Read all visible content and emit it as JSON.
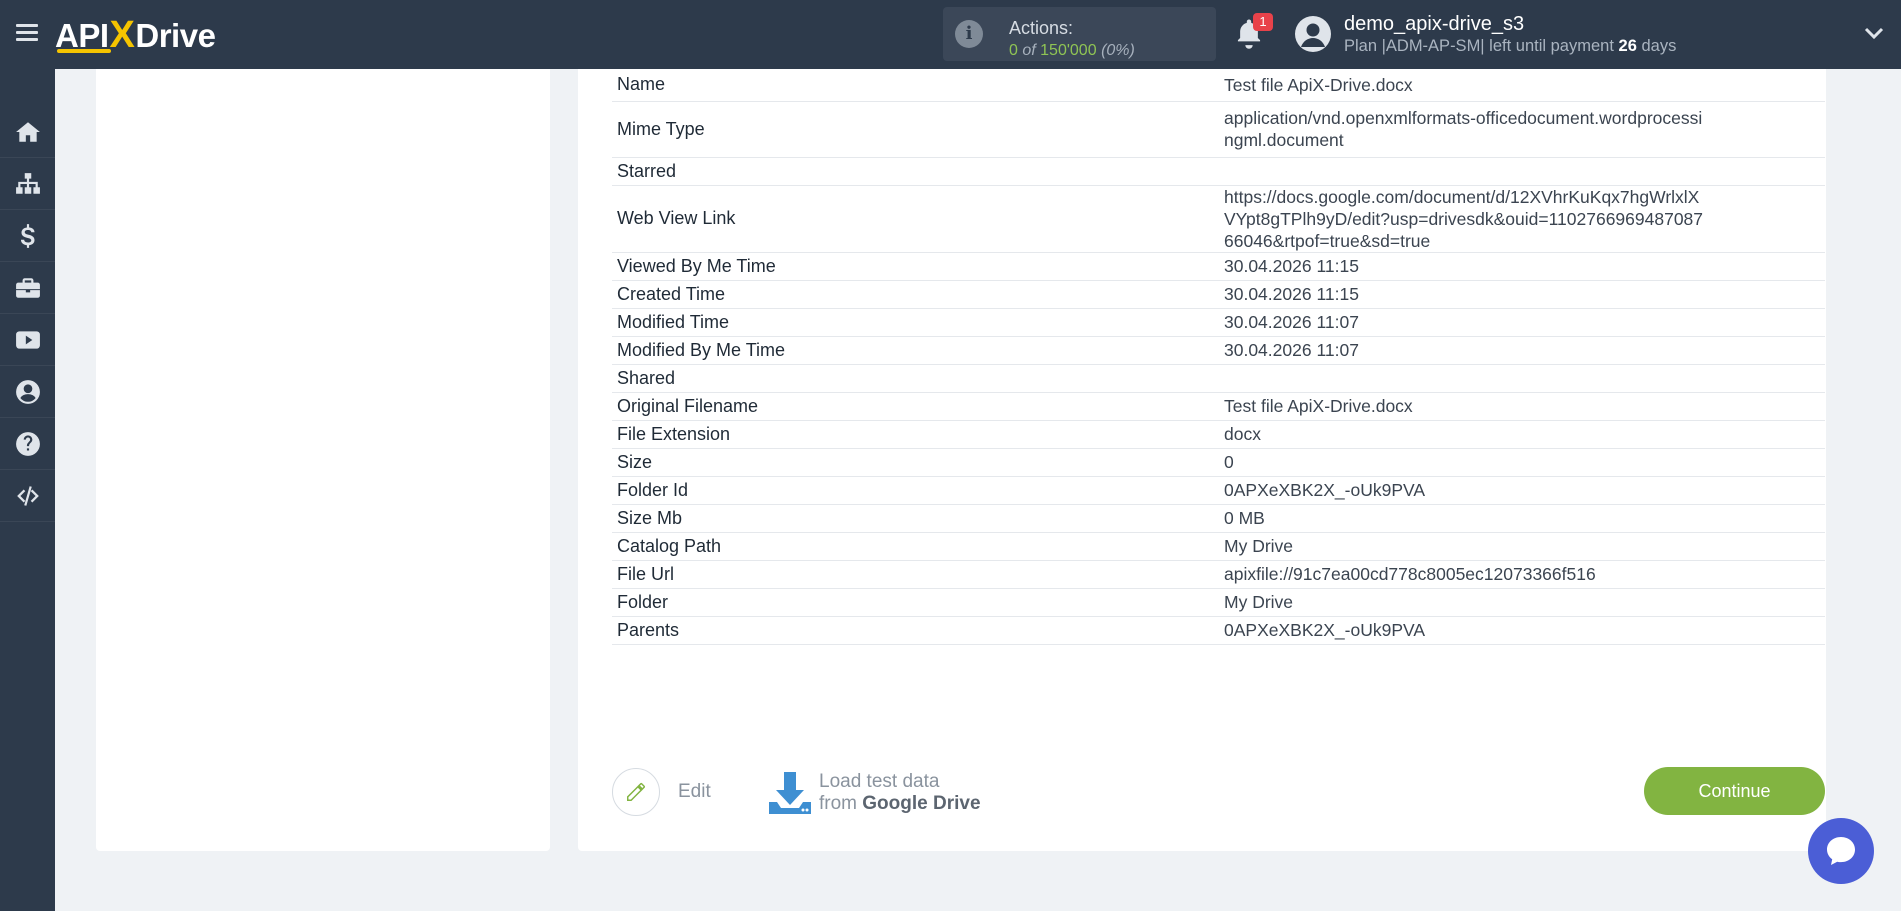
{
  "header": {
    "logo_prefix": "API",
    "logo_x": "X",
    "logo_suffix": "Drive",
    "actions_label": "Actions:",
    "actions_used": "0",
    "actions_of": "of",
    "actions_total": "150'000",
    "actions_percent": "(0%)",
    "notifications_count": "1",
    "user_name": "demo_apix-drive_s3",
    "plan_text": "Plan |ADM-AP-SM| left until payment",
    "days_left": "26",
    "days_unit": "days"
  },
  "sidebar": {
    "items": [
      {
        "icon": "home-icon"
      },
      {
        "icon": "sitemap-icon"
      },
      {
        "icon": "dollar-icon"
      },
      {
        "icon": "briefcase-icon"
      },
      {
        "icon": "youtube-icon"
      },
      {
        "icon": "user-circle-icon"
      },
      {
        "icon": "question-icon"
      },
      {
        "icon": "code-icon"
      }
    ]
  },
  "fields": [
    {
      "key": "Name",
      "value": "Test file ApiX-Drive.docx"
    },
    {
      "key": "Mime Type",
      "value": "application/vnd.openxmlformats-officedocument.wordprocessingml.document"
    },
    {
      "key": "Starred",
      "value": ""
    },
    {
      "key": "Web View Link",
      "value": "https://docs.google.com/document/d/12XVhrKuKqx7hgWrlxlXVYpt8gTPlh9yD/edit?usp=drivesdk&ouid=110276696948708766046&rtpof=true&sd=true"
    },
    {
      "key": "Viewed By Me Time",
      "value": "30.04.2026 11:15"
    },
    {
      "key": "Created Time",
      "value": "30.04.2026 11:15"
    },
    {
      "key": "Modified Time",
      "value": "30.04.2026 11:07"
    },
    {
      "key": "Modified By Me Time",
      "value": "30.04.2026 11:07"
    },
    {
      "key": "Shared",
      "value": ""
    },
    {
      "key": "Original Filename",
      "value": "Test file ApiX-Drive.docx"
    },
    {
      "key": "File Extension",
      "value": "docx"
    },
    {
      "key": "Size",
      "value": "0"
    },
    {
      "key": "Folder Id",
      "value": "0APXeXBK2X_-oUk9PVA"
    },
    {
      "key": "Size Mb",
      "value": "0 MB"
    },
    {
      "key": "Catalog Path",
      "value": "My Drive"
    },
    {
      "key": "File Url",
      "value": "apixfile://91c7ea00cd778c8005ec12073366f516"
    },
    {
      "key": "Folder",
      "value": "My Drive"
    },
    {
      "key": "Parents",
      "value": "0APXeXBK2X_-oUk9PVA"
    }
  ],
  "footer": {
    "edit_label": "Edit",
    "load_line1": "Load test data",
    "load_from": "from",
    "load_source": "Google Drive",
    "continue_label": "Continue"
  },
  "colors": {
    "topbar": "#2d3a4b",
    "accent_green": "#82b441",
    "logo_yellow": "#f5c400",
    "badge_red": "#e8424a",
    "chat_blue": "#4b5ed6"
  }
}
